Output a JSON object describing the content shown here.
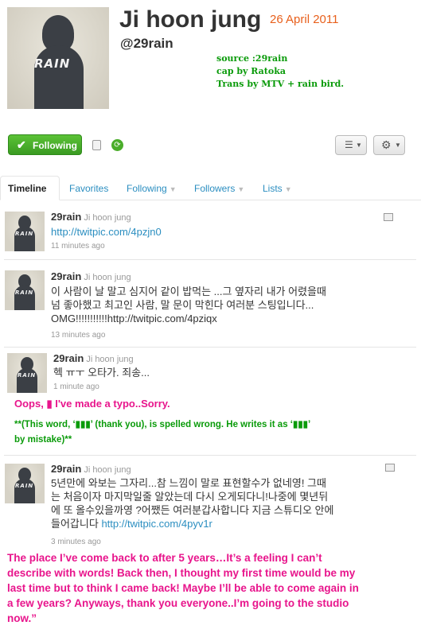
{
  "profile": {
    "name": "Ji hoon jung",
    "date": "26 April 2011",
    "handle": "@29rain",
    "avatar_text": "RAIN",
    "credits": [
      "source :29rain",
      "cap by Ratoka",
      "Trans by MTV + rain bird."
    ]
  },
  "actions": {
    "following_label": "Following",
    "menu_icon": "list-icon",
    "settings_icon": "gear-icon",
    "colors": {
      "following_bg": "#4aad2a",
      "link": "#2b8ec0",
      "accent": "#e8601c",
      "note_pink": "#e8158c",
      "note_green": "#0a9b0a"
    }
  },
  "tabs": [
    {
      "label": "Timeline",
      "active": true
    },
    {
      "label": "Favorites"
    },
    {
      "label": "Following",
      "dropdown": true
    },
    {
      "label": "Followers",
      "dropdown": true
    },
    {
      "label": "Lists",
      "dropdown": true
    }
  ],
  "tweets": [
    {
      "user": "29rain",
      "fullname": "Ji hoon jung",
      "link": "http://twitpic.com/4pzjn0",
      "time": "11 minutes ago"
    },
    {
      "user": "29rain",
      "fullname": "Ji hoon jung",
      "text_lines": [
        "이 사람이 날 말고 심지어 같이 밥먹는 ...그 옆자리 내가 어렸을때",
        "넘 좋아했고 최고인 사람, 말 문이 막힌다 여러분 스팅입니다..."
      ],
      "text_line3": "OMG!!!!!!!!!!!http://twitpic.com/4pziqx",
      "time": "13 minutes ago"
    },
    {
      "user": "29rain",
      "fullname": "Ji hoon jung",
      "text": "헥 ㅠㅜ 오타가. 죄송...",
      "time": "1 minute ago",
      "note_typo": "Oops, ▮ I've made a typo..Sorry.",
      "note_spelling_1": "**(This word, ‘▮▮▮’ (thank you), is spelled wrong. He writes it as ‘▮▮▮’",
      "note_spelling_2": "by mistake)**"
    },
    {
      "user": "29rain",
      "fullname": "Ji hoon jung",
      "text_lines": [
        "5년만에 와보는 그자리...참 느낌이 말로 표현할수가 없네영! 그때",
        "는 처음이자 마지막일줄 알았는데 다시 오게되다니!나중에 몇년뒤",
        "에 또 올수있을까영 ?어쨌든 여러분갑사합니다 지금 스튜디오 안에"
      ],
      "text_line4": "들어갑니다",
      "link": "http://twitpic.com/4pyv1r",
      "time": "3 minutes ago",
      "translation_lines": [
        "The place I’ve come back to after 5 years…It’s a feeling I can’t",
        "describe with words! Back then, I thought my first time would be my",
        "last time but to think I came back! Maybe I’ll be able to come again in",
        "a few years? Anyways, thank you everyone..I’m going to the studio",
        "now.”"
      ]
    }
  ]
}
